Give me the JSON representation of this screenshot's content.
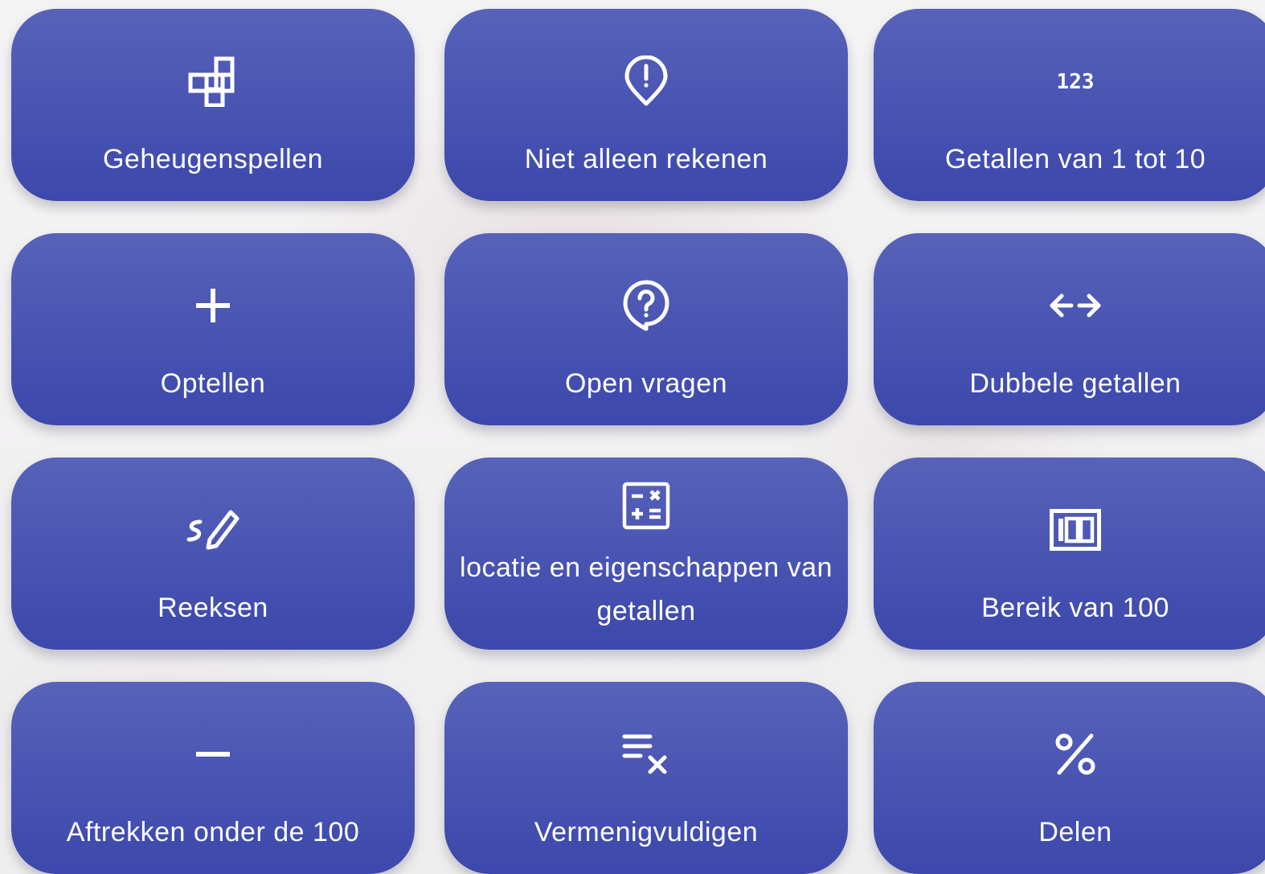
{
  "tiles": [
    {
      "label": "Geheugenspellen",
      "icon": "grid-blocks-icon"
    },
    {
      "label": "Niet alleen rekenen",
      "icon": "map-pin-alert-icon"
    },
    {
      "label": "Getallen van 1 tot 10",
      "icon": "numbers-123-icon"
    },
    {
      "label": "Optellen",
      "icon": "plus-icon"
    },
    {
      "label": "Open vragen",
      "icon": "question-bubble-icon"
    },
    {
      "label": "Dubbele getallen",
      "icon": "arrows-left-right-icon"
    },
    {
      "label": "Reeksen",
      "icon": "draw-pencil-icon"
    },
    {
      "label": "locatie en eigenschappen van getallen",
      "icon": "calculator-icon"
    },
    {
      "label": "Bereik van 100",
      "icon": "counter-100-icon"
    },
    {
      "label": "Aftrekken onder de 100",
      "icon": "minus-icon"
    },
    {
      "label": "Vermenigvuldigen",
      "icon": "list-times-icon"
    },
    {
      "label": "Delen",
      "icon": "percent-icon"
    }
  ],
  "colors": {
    "tile_top": "#5762b9",
    "tile_bottom": "#3c48ab",
    "text": "#ffffff",
    "background": "#f2f1f2"
  }
}
